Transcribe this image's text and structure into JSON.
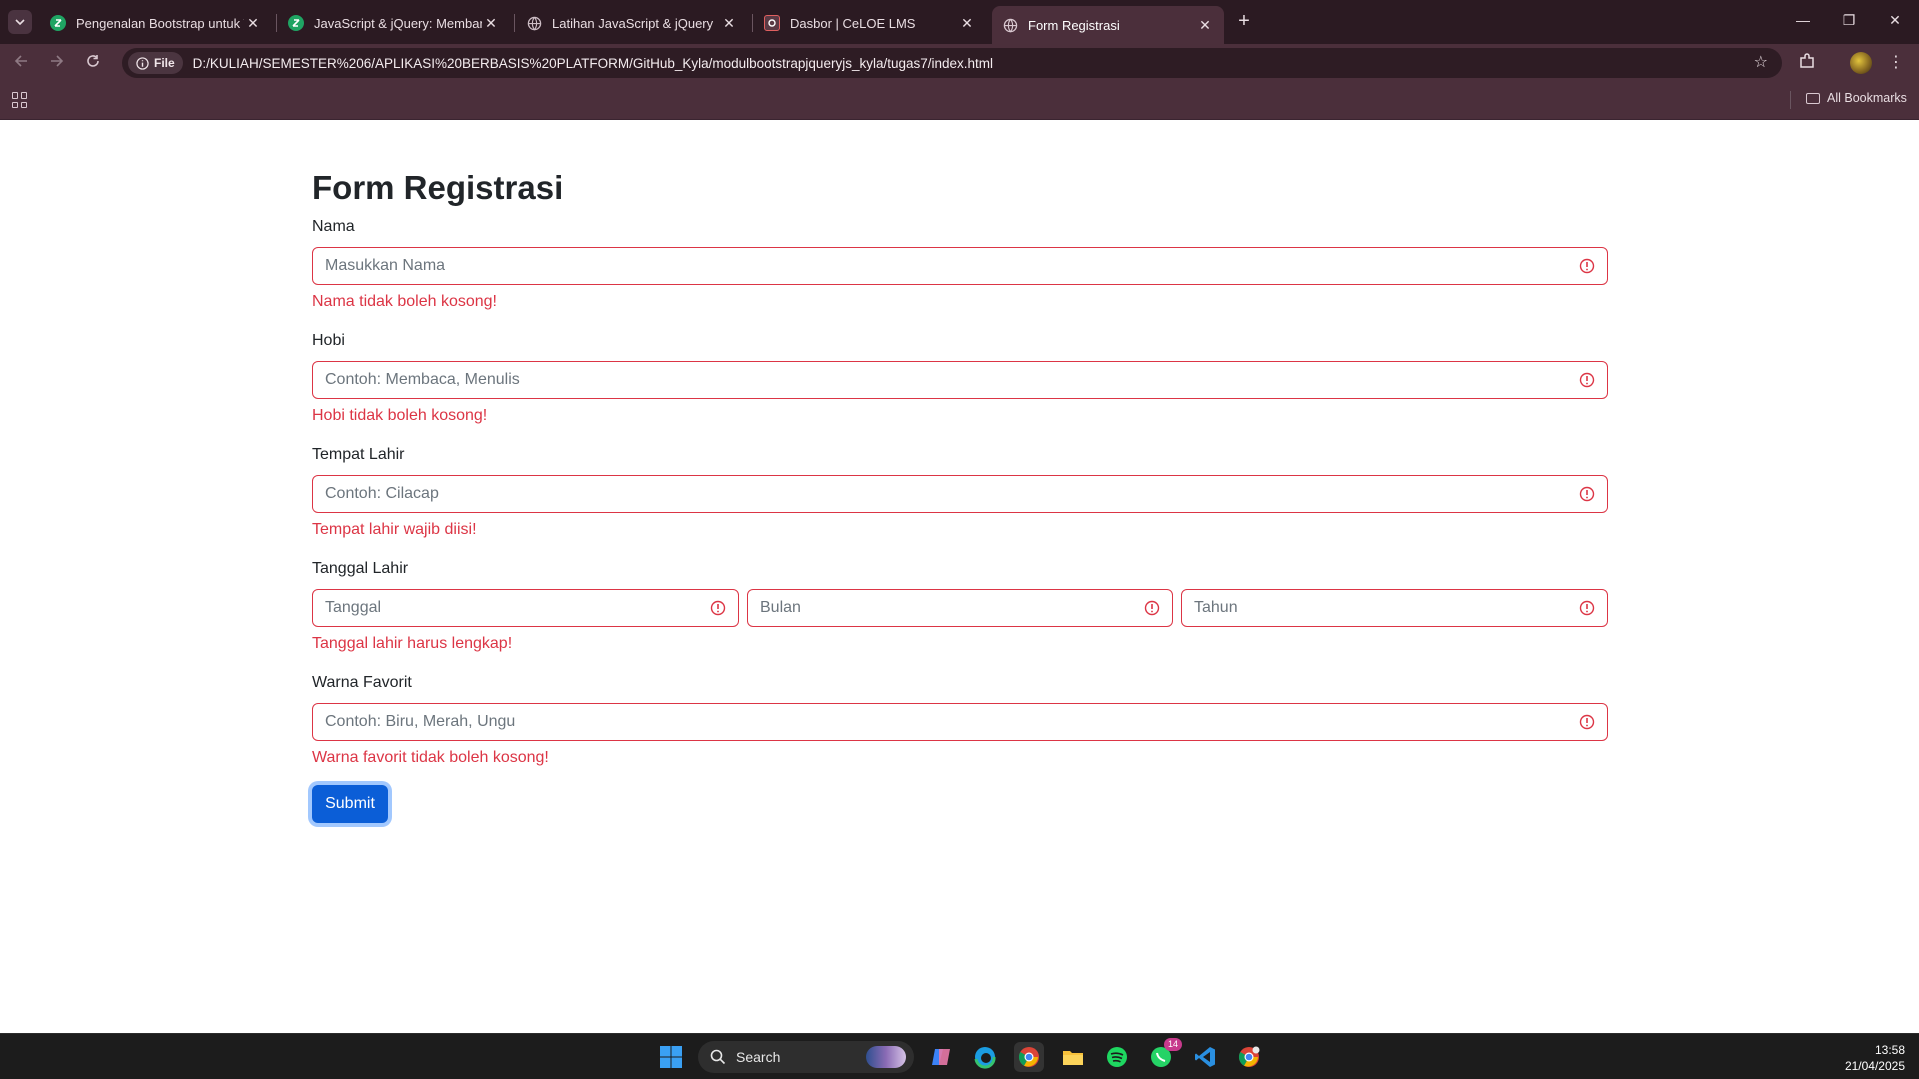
{
  "browser": {
    "tabs": [
      {
        "title": "Pengenalan Bootstrap untuk W",
        "favicon": "green-logo-icon",
        "active": false
      },
      {
        "title": "JavaScript & jQuery: Membang",
        "favicon": "green-logo-icon",
        "active": false
      },
      {
        "title": "Latihan JavaScript & jQuery",
        "favicon": "globe-icon",
        "active": false
      },
      {
        "title": "Dasbor | CeLOE LMS",
        "favicon": "celoe-icon",
        "active": false
      },
      {
        "title": "Form Registrasi",
        "favicon": "globe-icon",
        "active": true
      }
    ],
    "address": {
      "chip_label": "File",
      "url": "D:/KULIAH/SEMESTER%206/APLIKASI%20BERBASIS%20PLATFORM/GitHub_Kyla/modulbootstrapjqueryjs_kyla/tugas7/index.html"
    },
    "bookmarks": {
      "all_label": "All Bookmarks"
    }
  },
  "form": {
    "title": "Form Registrasi",
    "fields": [
      {
        "label": "Nama",
        "placeholder": "Masukkan Nama",
        "error": "Nama tidak boleh kosong!"
      },
      {
        "label": "Hobi",
        "placeholder": "Contoh: Membaca, Menulis",
        "error": "Hobi tidak boleh kosong!"
      },
      {
        "label": "Tempat Lahir",
        "placeholder": "Contoh: Cilacap",
        "error": "Tempat lahir wajib diisi!"
      },
      {
        "label": "Tanggal Lahir",
        "placeholders": [
          "Tanggal",
          "Bulan",
          "Tahun"
        ],
        "error": "Tanggal lahir harus lengkap!"
      },
      {
        "label": "Warna Favorit",
        "placeholder": "Contoh: Biru, Merah, Ungu",
        "error": "Warna favorit tidak boleh kosong!"
      }
    ],
    "submit_label": "Submit",
    "error_color": "#dc3545",
    "button_color": "#0b5ed7"
  },
  "taskbar": {
    "search_label": "Search",
    "whatsapp_badge": "14",
    "time": "13:58",
    "date": "21/04/2025"
  }
}
